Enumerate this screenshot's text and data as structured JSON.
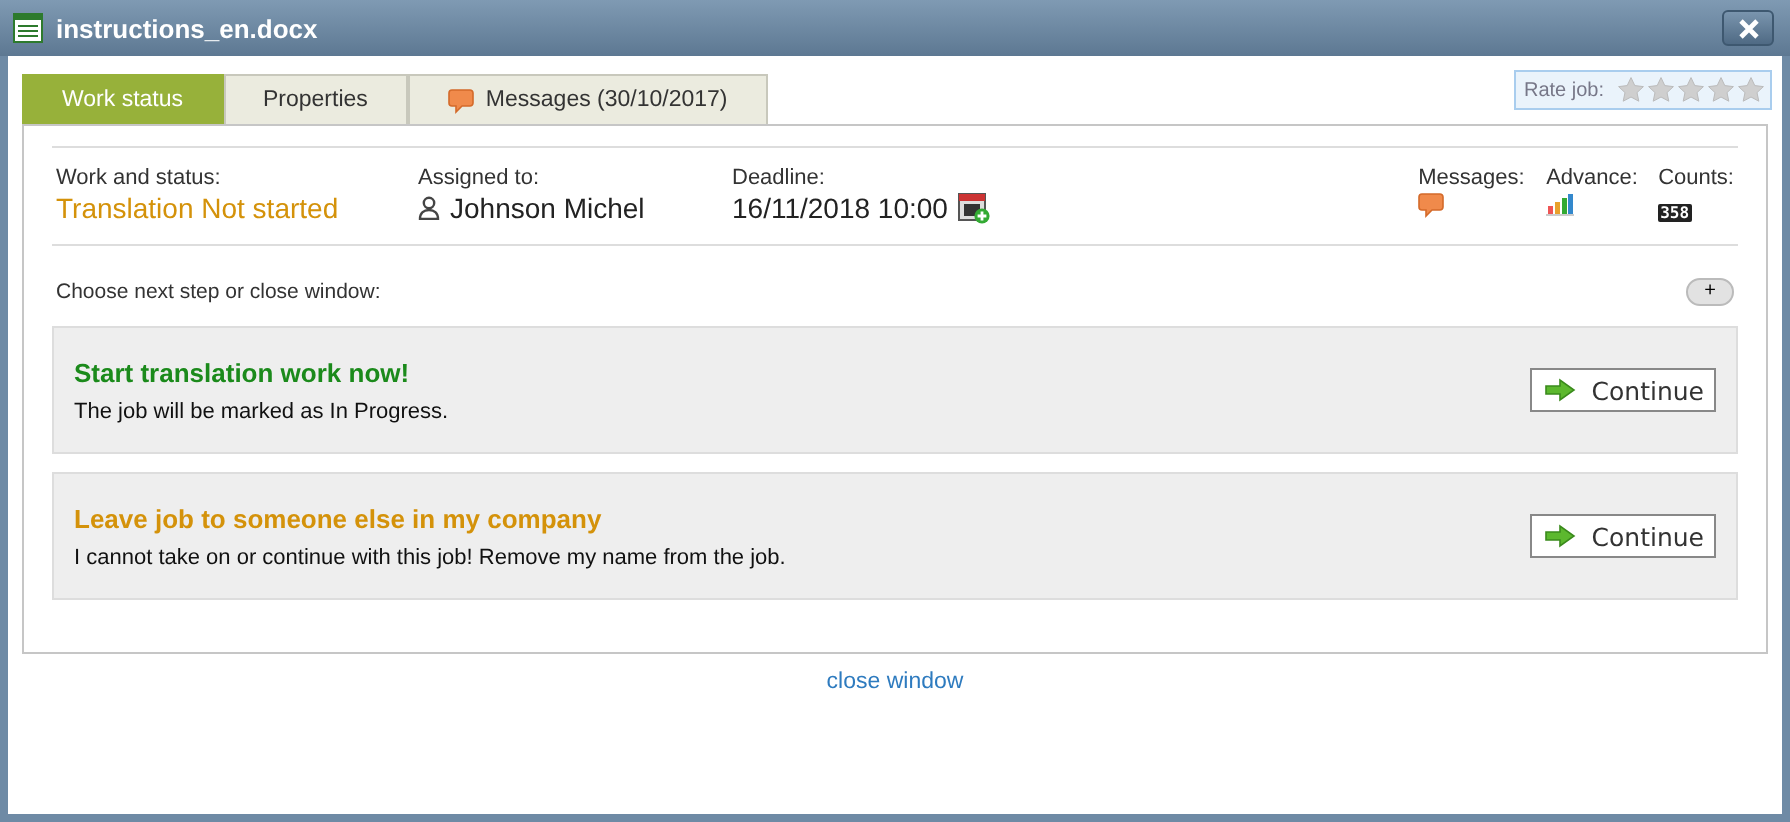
{
  "window": {
    "title": "instructions_en.docx"
  },
  "tabs": [
    {
      "label": "Work status",
      "selected": true,
      "icon": false
    },
    {
      "label": "Properties",
      "selected": false,
      "icon": false
    },
    {
      "label": "Messages (30/10/2017)",
      "selected": false,
      "icon": true
    }
  ],
  "rating": {
    "label": "Rate job:",
    "stars": 0
  },
  "info": {
    "status_label": "Work and status:",
    "status_value": "Translation Not started",
    "assigned_label": "Assigned to:",
    "assigned_value": "Johnson Michel",
    "deadline_label": "Deadline:",
    "deadline_value": "16/11/2018 10:00",
    "messages_label": "Messages:",
    "advance_label": "Advance:",
    "counts_label": "Counts:",
    "counts_value": "358"
  },
  "prompt": "Choose next step or close window:",
  "expand_button": "+",
  "options": [
    {
      "kind": "start",
      "title": "Start translation work now!",
      "description": "The job will be marked as In Progress.",
      "button": "Continue"
    },
    {
      "kind": "leave",
      "title": "Leave job to someone else in my company",
      "description": "I cannot take on or continue with this job! Remove my name from the job.",
      "button": "Continue"
    }
  ],
  "close_link": "close window"
}
